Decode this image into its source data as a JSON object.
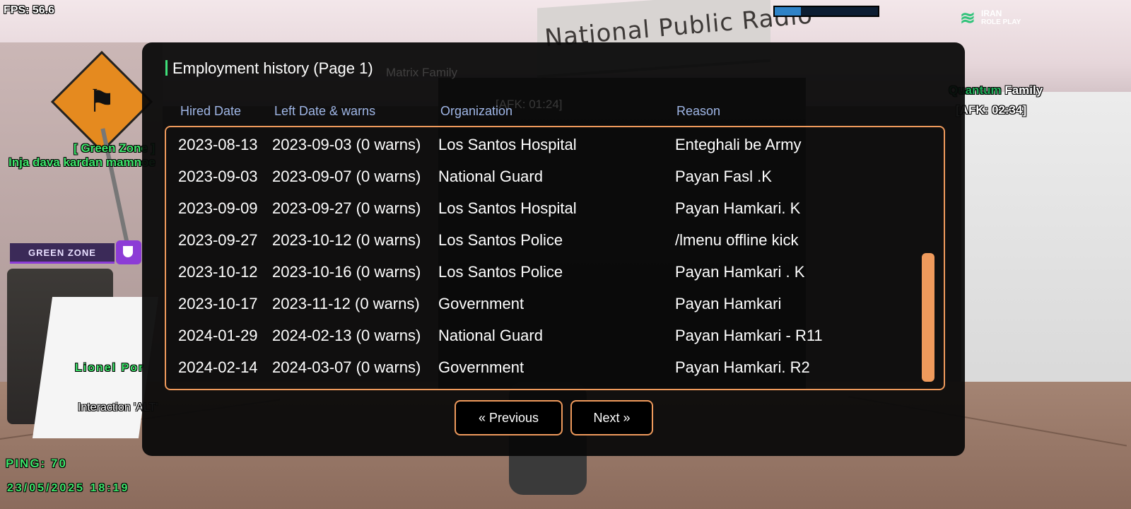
{
  "hud": {
    "fps": "FPS: 56.6",
    "health_fraction": 0.25,
    "logo_line1": "IRAN",
    "logo_line2": "ROLE PLAY",
    "zone_label": "[ Green Zone ]",
    "zone_desc": "Inja dava kardan mamnoe",
    "green_zone_badge": "GREEN ZONE",
    "player_name": "Lionel Por",
    "interaction": "Interaction 'ALT'",
    "ping": "PING: 70",
    "datetime": "23/05/2025 18:19",
    "family_tag_prefix": "Quantum",
    "family_tag_suffix": " Family",
    "afk_tag": "[AFK: 02:34]"
  },
  "scene": {
    "sign_text": "National Public Radio"
  },
  "dialog": {
    "title": "Employment history (Page 1)",
    "ghost_matrix": "Matrix Family",
    "ghost_afk": "[AFK: 01:24]",
    "columns": [
      "Hired Date",
      "Left Date & warns",
      "Organization",
      "Reason"
    ],
    "rows": [
      {
        "hired": "2023-08-13",
        "left": "2023-09-03 (0 warns)",
        "org": "Los Santos Hospital",
        "reason": "Enteghali be Army"
      },
      {
        "hired": "2023-09-03",
        "left": "2023-09-07 (0 warns)",
        "org": "National Guard",
        "reason": "Payan Fasl .K"
      },
      {
        "hired": "2023-09-09",
        "left": "2023-09-27 (0 warns)",
        "org": "Los Santos Hospital",
        "reason": "Payan Hamkari. K"
      },
      {
        "hired": "2023-09-27",
        "left": "2023-10-12 (0 warns)",
        "org": "Los Santos Police",
        "reason": "/lmenu offline kick"
      },
      {
        "hired": "2023-10-12",
        "left": "2023-10-16 (0 warns)",
        "org": "Los Santos Police",
        "reason": "Payan Hamkari . K"
      },
      {
        "hired": "2023-10-17",
        "left": "2023-11-12 (0 warns)",
        "org": "Government",
        "reason": "Payan Hamkari"
      },
      {
        "hired": "2024-01-29",
        "left": "2024-02-13 (0 warns)",
        "org": "National Guard",
        "reason": "Payan Hamkari - R11"
      },
      {
        "hired": "2024-02-14",
        "left": "2024-03-07 (0 warns)",
        "org": "Government",
        "reason": "Payan Hamkari. R2"
      }
    ],
    "prev_label": "« Previous",
    "next_label": "Next »"
  },
  "colors": {
    "accent_orange": "#ef9a5c",
    "header_blue": "#9fb6e6",
    "title_marker_green": "#3fe07a",
    "hud_green": "#3ee56b"
  }
}
